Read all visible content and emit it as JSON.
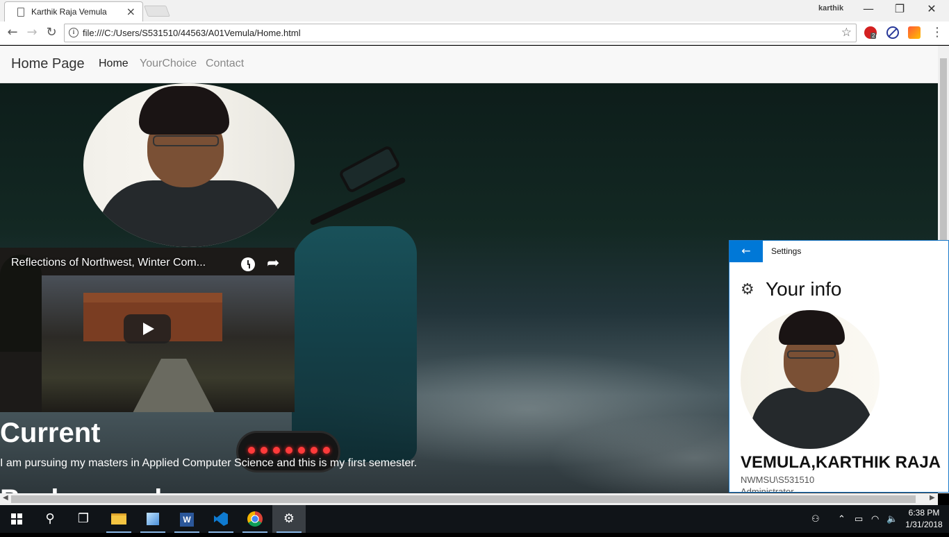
{
  "browser": {
    "tab_title": "Karthik Raja Vemula",
    "tab_close": "×",
    "profile_name": "karthik",
    "window_minimize": "—",
    "window_restore": "❐",
    "window_close": "✕",
    "back": "←",
    "forward": "→",
    "reload": "↻",
    "url": "file:///C:/Users/S531510/44563/A01Vemula/Home.html",
    "info_glyph": "i",
    "star": "☆",
    "extension_badge": "2",
    "menu": "⋮"
  },
  "page": {
    "brand": "Home Page",
    "nav": [
      {
        "label": "Home",
        "active": true
      },
      {
        "label": "YourChoice",
        "active": false
      },
      {
        "label": "Contact",
        "active": false
      }
    ],
    "video": {
      "title": "Reflections of Northwest, Winter Com...",
      "share": "➦"
    },
    "current_heading": "Current",
    "current_text": "I am pursuing my masters in Applied Computer Science and this is my first semester.",
    "next_heading": "Background"
  },
  "settings": {
    "back": "←",
    "window_title": "Settings",
    "gear": "⚙",
    "header": "Your info",
    "name": "VEMULA,KARTHIK RAJA",
    "account": "NWMSU\\S531510",
    "role": "Administrator"
  },
  "taskbar": {
    "search": "⚲",
    "task_view": "❐",
    "settings": "⚙",
    "people": "⚇",
    "chevron": "⌃",
    "battery": "▭",
    "wifi": "◠",
    "volume": "🔈",
    "word_letter": "W",
    "time": "6:38 PM",
    "date": "1/31/2018"
  },
  "colors": {
    "accent": "#0078d7",
    "taskbar": "#101418",
    "navbar": "#f8f8f8"
  }
}
